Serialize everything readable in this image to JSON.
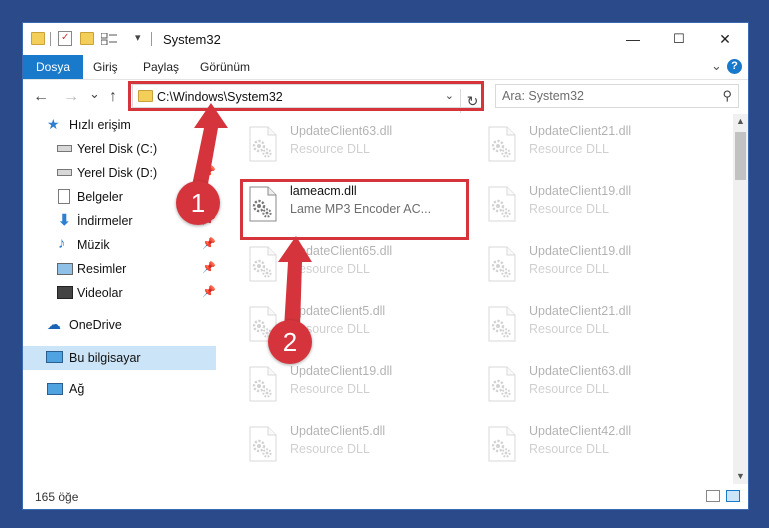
{
  "window": {
    "title": "System32",
    "controls": {
      "minimize": "—",
      "maximize": "☐",
      "close": "✕"
    }
  },
  "ribbon": {
    "tabs": [
      {
        "label": "Dosya",
        "active": true
      },
      {
        "label": "Giriş"
      },
      {
        "label": "Paylaş"
      },
      {
        "label": "Görünüm"
      }
    ],
    "expand_icon": "chevron-down-icon",
    "help_label": "?"
  },
  "nav": {
    "back": "←",
    "forward": "→",
    "recent": "⌄",
    "up": "↑",
    "address": "C:\\Windows\\System32",
    "search_placeholder": "Ara: System32"
  },
  "sidebar": {
    "items": [
      {
        "label": "Hızlı erişim",
        "icon": "star-icon"
      },
      {
        "label": "Yerel Disk (C:)",
        "icon": "drive-icon",
        "pinned": true
      },
      {
        "label": "Yerel Disk (D:)",
        "icon": "drive-icon",
        "pinned": true
      },
      {
        "label": "Belgeler",
        "icon": "documents-icon",
        "pinned": true
      },
      {
        "label": "İndirmeler",
        "icon": "download-icon",
        "pinned": true
      },
      {
        "label": "Müzik",
        "icon": "music-icon",
        "pinned": true
      },
      {
        "label": "Resimler",
        "icon": "pictures-icon",
        "pinned": true
      },
      {
        "label": "Videolar",
        "icon": "videos-icon",
        "pinned": true
      },
      {
        "label": "OneDrive",
        "icon": "cloud-icon"
      },
      {
        "label": "Bu bilgisayar",
        "icon": "computer-icon",
        "selected": true
      },
      {
        "label": "Ağ",
        "icon": "network-icon"
      }
    ]
  },
  "files": {
    "left": [
      {
        "name": "UpdateClient63.dll",
        "desc": "Resource DLL",
        "faded": true
      },
      {
        "name": "lameacm.dll",
        "desc": "Lame MP3 Encoder AC...",
        "faded": false
      },
      {
        "name": "UpdateClient65.dll",
        "desc": "Resource DLL",
        "faded": true
      },
      {
        "name": "UpdateClient5.dll",
        "desc": "Resource DLL",
        "faded": true
      },
      {
        "name": "UpdateClient19.dll",
        "desc": "Resource DLL",
        "faded": true
      },
      {
        "name": "UpdateClient5.dll",
        "desc": "Resource DLL",
        "faded": true
      }
    ],
    "right": [
      {
        "name": "UpdateClient21.dll",
        "desc": "Resource DLL",
        "faded": true
      },
      {
        "name": "UpdateClient19.dll",
        "desc": "Resource DLL",
        "faded": true
      },
      {
        "name": "UpdateClient19.dll",
        "desc": "Resource DLL",
        "faded": true
      },
      {
        "name": "UpdateClient21.dll",
        "desc": "Resource DLL",
        "faded": true
      },
      {
        "name": "UpdateClient63.dll",
        "desc": "Resource DLL",
        "faded": true
      },
      {
        "name": "UpdateClient42.dll",
        "desc": "Resource DLL",
        "faded": true
      }
    ]
  },
  "status": {
    "count": "165 öğe"
  },
  "annotations": {
    "step1": "1",
    "step2": "2",
    "color": "#d6343c"
  },
  "colors": {
    "accent": "#1979ca",
    "highlight": "#d6343c",
    "selected": "#cce4f7"
  }
}
